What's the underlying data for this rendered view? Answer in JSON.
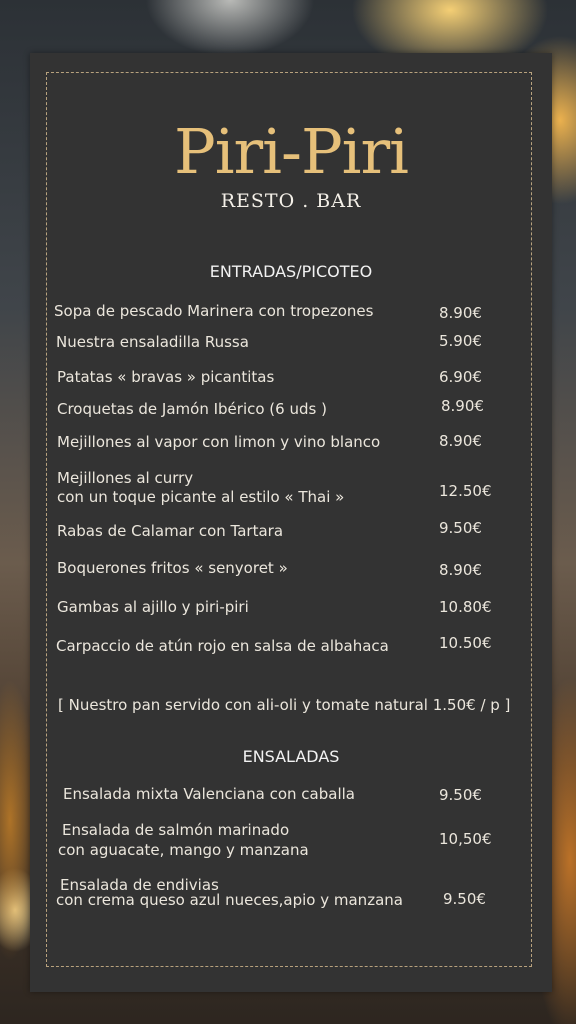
{
  "brand": {
    "name": "Piri-Piri",
    "tagline": "RESTO . BAR"
  },
  "sections": [
    {
      "title": "ENTRADAS/PICOTEO",
      "items": [
        {
          "name": "Sopa de pescado Marinera con tropezones",
          "price": "8.90€"
        },
        {
          "name": "Nuestra ensaladilla Russa",
          "price": "5.90€"
        },
        {
          "name": "Patatas « bravas » picantitas",
          "price": "6.90€"
        },
        {
          "name": "Croquetas de Jamón Ibérico (6 uds )",
          "price": "8.90€"
        },
        {
          "name": "Mejillones al vapor con limon y vino blanco",
          "price": "8.90€"
        },
        {
          "name_line1": "Mejillones al curry",
          "name_line2": "con un toque picante al estilo « Thai »",
          "price": "12.50€"
        },
        {
          "name": "Rabas de Calamar con Tartara",
          "price": "9.50€"
        },
        {
          "name": "Boquerones fritos « senyoret »",
          "price": "8.90€"
        },
        {
          "name": "Gambas al ajillo y piri-piri",
          "price": "10.80€"
        },
        {
          "name": "Carpaccio de atún rojo en salsa de albahaca",
          "price": "10.50€"
        }
      ]
    },
    {
      "title": "ENSALADAS",
      "items": [
        {
          "name": "Ensalada mixta Valenciana con caballa",
          "price": "9.50€"
        },
        {
          "name_line1": "Ensalada de salmón marinado",
          "name_line2": "con aguacate, mango y manzana",
          "price": "10,50€"
        },
        {
          "name_line1": "Ensalada de endivias",
          "name_line2": "con crema queso azul nueces,apio y manzana",
          "price": "9.50€"
        }
      ]
    }
  ],
  "bread_note": "[ Nuestro pan servido con ali-oli y tomate natural 1.50€ / p ]"
}
